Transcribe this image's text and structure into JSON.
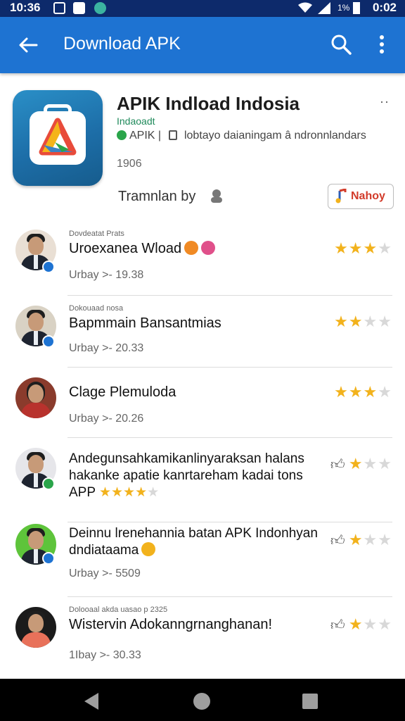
{
  "status_bar": {
    "time": "10:36",
    "battery_pct": "1%",
    "clock_right": "0:02"
  },
  "app_bar": {
    "title": "Download APK",
    "icons": [
      "back-arrow-icon",
      "search-icon",
      "more-vert-icon"
    ]
  },
  "app": {
    "name": "APIK Indload Indosia",
    "developer": "Indaoadt",
    "meta_tag": "APIK",
    "meta_text": "lobtayo daianingam â ndronnlandars",
    "count": "1906",
    "translation_label": "Tramnlan by",
    "follow_button": "Nahoy",
    "more_icon": "more-horizontal-icon"
  },
  "reviews": [
    {
      "small": "Dovdeatat Prats",
      "title": "Uroexanea Wload",
      "meta": "Urbay >- 19.38",
      "stars": 3,
      "thumb": false,
      "badge_color": "#1e73d2"
    },
    {
      "small": "Dokouaad nosa",
      "title": "Bapmmain Bansantmias",
      "meta": "Urbay >- 20.33",
      "stars": 2,
      "thumb": false,
      "badge_color": "#1e73d2"
    },
    {
      "small": "",
      "title": "Clage Plemuloda",
      "meta": "Urbay >- 20.26",
      "stars": 3,
      "thumb": false,
      "badge_color": ""
    },
    {
      "small": "",
      "title": "Andegunsahkamikanlinyaraksan halans hakanke apatie kanrtareham kadai tons APP",
      "meta": "",
      "stars": 2,
      "thumb": true,
      "inline_stars": 4,
      "badge_color": "#2aa54a"
    },
    {
      "small": "",
      "title": "Deinnu lrenehannia batan APK Indonhyan dndiataama",
      "meta": "Urbay >- 5509",
      "stars": 2,
      "thumb": true,
      "badge_color": "#1e73d2"
    },
    {
      "small": "Dolooaal akda uasao p 2325",
      "title": "Wistervin Adokanngrnanghanan!",
      "meta": "1Ibay >- 30.33",
      "stars": 1,
      "thumb": true,
      "badge_color": ""
    }
  ],
  "nav_bar": {
    "icons": [
      "nav-back-icon",
      "nav-home-icon",
      "nav-recents-icon"
    ]
  },
  "colors": {
    "app_bar": "#1e73d2",
    "status_bar": "#0d2a6b",
    "star": "#f2b21c",
    "follow_text": "#d23b2a"
  }
}
